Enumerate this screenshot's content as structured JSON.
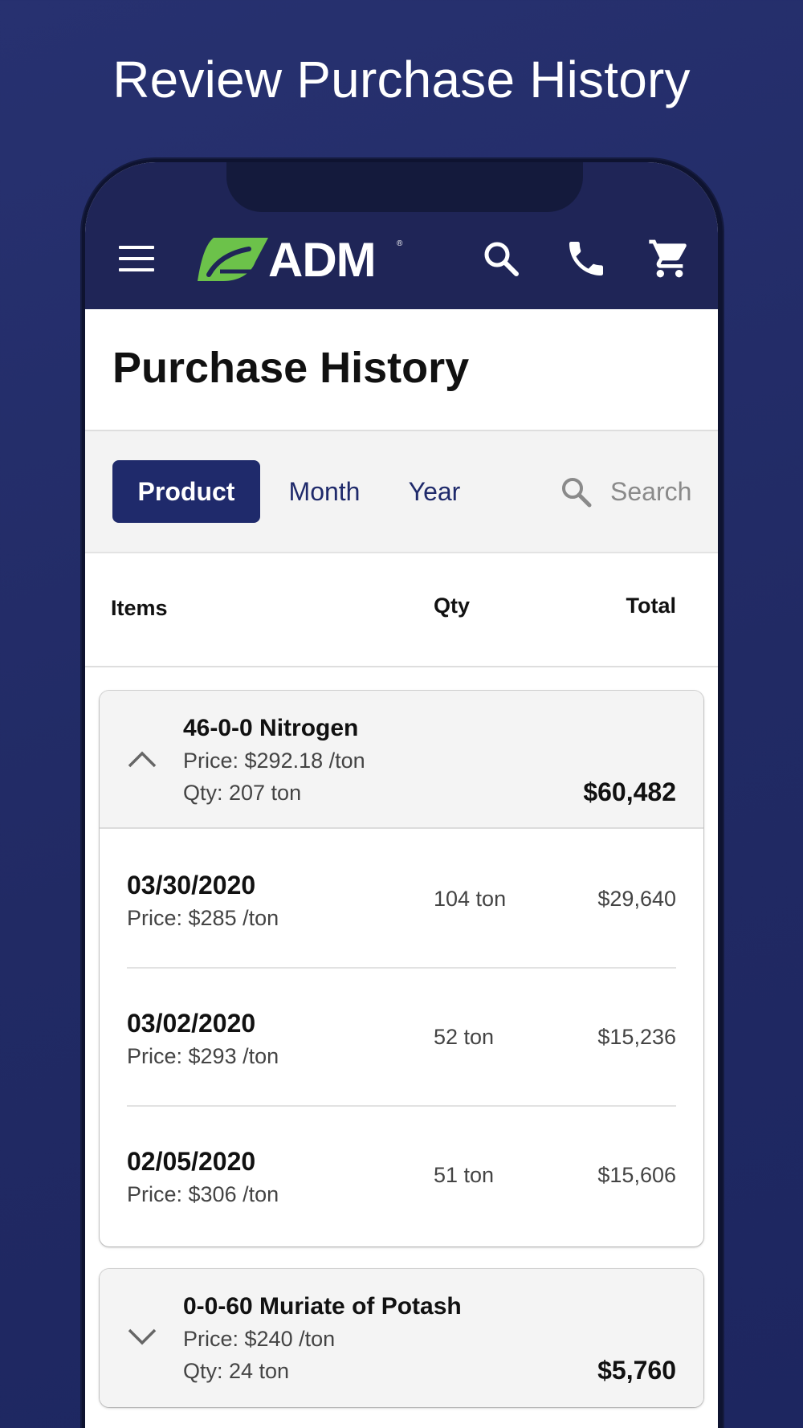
{
  "headline": "Review Purchase History",
  "header": {
    "logo_text": "ADM",
    "logo_reg": "®",
    "icons": [
      "menu-icon",
      "search-icon",
      "phone-icon",
      "cart-icon"
    ],
    "background": "#1f2557",
    "logo_green": "#6cc24a"
  },
  "page": {
    "title": "Purchase History"
  },
  "filters": {
    "tabs": [
      "Product",
      "Month",
      "Year"
    ],
    "active_tab": "Product",
    "search_placeholder": "Search",
    "accent": "#1f2a6b"
  },
  "columns": {
    "items": "Items",
    "qty": "Qty",
    "total": "Total"
  },
  "products": [
    {
      "name": "46-0-0 Nitrogen",
      "price": "Price: $292.18 /ton",
      "qty": "Qty: 207 ton",
      "total": "$60,482",
      "expanded": true,
      "purchases": [
        {
          "date": "03/30/2020",
          "price": "Price: $285 /ton",
          "qty": "104 ton",
          "total": "$29,640"
        },
        {
          "date": "03/02/2020",
          "price": "Price: $293 /ton",
          "qty": "52 ton",
          "total": "$15,236"
        },
        {
          "date": "02/05/2020",
          "price": "Price: $306 /ton",
          "qty": "51 ton",
          "total": "$15,606"
        }
      ]
    },
    {
      "name": "0-0-60 Muriate of Potash",
      "price": "Price: $240 /ton",
      "qty": "Qty: 24 ton",
      "total": "$5,760",
      "expanded": false
    }
  ]
}
